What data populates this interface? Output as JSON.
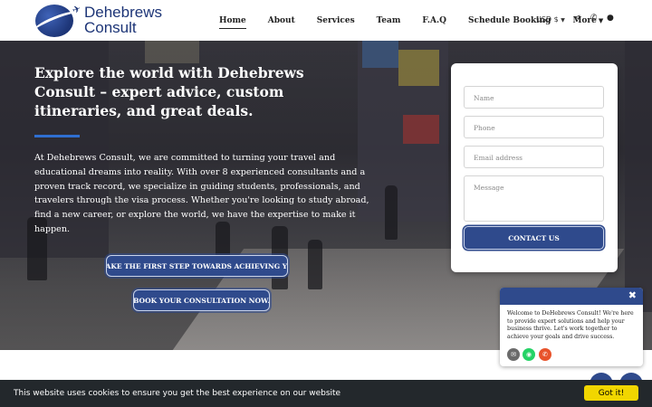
{
  "brand": {
    "line1": "Dehebrews",
    "line2": "Consult",
    "logo_icon": "globe-plane-logo"
  },
  "nav": {
    "items": [
      "Home",
      "About",
      "Services",
      "Team",
      "F.A.Q",
      "Schedule Booking",
      "More"
    ],
    "active": "Home",
    "currency": "USD $",
    "icons": [
      "share-icon",
      "phone-icon",
      "user-icon"
    ]
  },
  "hero": {
    "title": "Explore the world with Dehebrews Consult – expert advice, custom itineraries, and great deals.",
    "body": "At Dehebrews Consult, we are committed to turning your travel and educational dreams into reality. With over 8 experienced consultants and a proven track record, we specialize in guiding students, professionals, and travelers through the visa process. Whether you're looking to study abroad, find a new career, or explore the world, we have the expertise to make it happen.",
    "cta_primary": "TAKE THE FIRST STEP TOWARDS ACHIEVING YO",
    "cta_secondary": "BOOK YOUR CONSULTATION NOW."
  },
  "contact_form": {
    "name_placeholder": "Name",
    "phone_placeholder": "Phone",
    "email_placeholder": "Email address",
    "message_placeholder": "Message",
    "submit_label": "CONTACT US"
  },
  "chat": {
    "message": "Welcome to DeHebrews Consult! We're here to provide expert solutions and help your business thrive. Let's work together to achieve your goals and drive success.",
    "close_symbol": "✖",
    "icons": [
      "email-icon",
      "whatsapp-icon",
      "phone-icon"
    ]
  },
  "cookie": {
    "text": "This website uses cookies to ensure you get the best experience on our website",
    "button": "Got it!"
  },
  "colors": {
    "primary": "#2f4a8c",
    "accent_line": "#2f6fd1",
    "cookie_bg": "#23282c",
    "cookie_button": "#f1d600",
    "whatsapp": "#25d366",
    "phone": "#e8532b",
    "email": "#6b6b6b"
  }
}
